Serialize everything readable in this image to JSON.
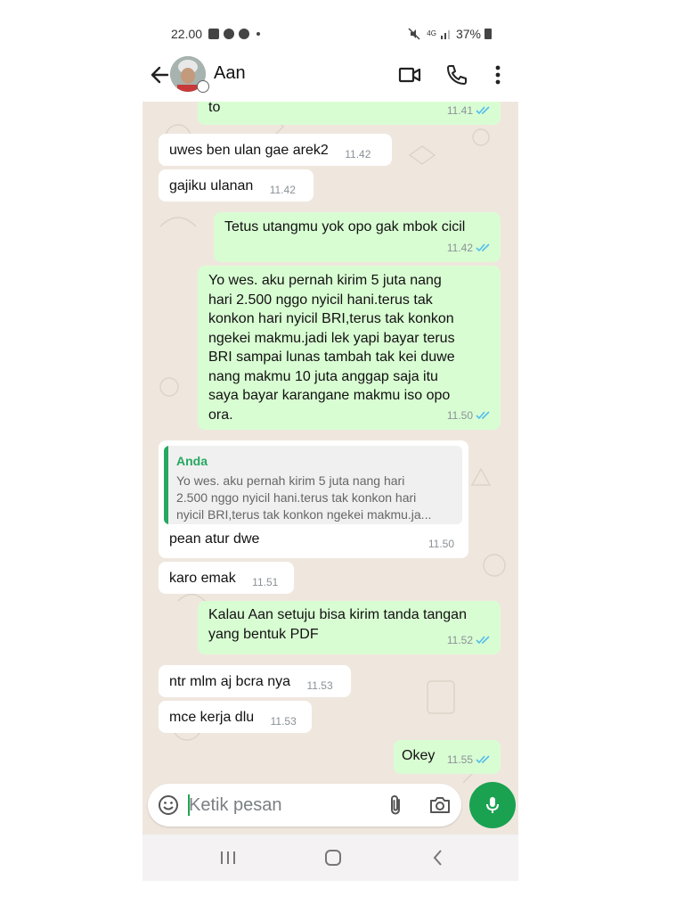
{
  "status_bar": {
    "time": "22.00",
    "network": "4G",
    "battery": "37%",
    "icons_left": [
      "gallery-icon",
      "chrome-icon",
      "chrome-icon",
      "dot"
    ],
    "icons_right": [
      "mute-icon",
      "network-icon",
      "signal-icon",
      "battery-icon"
    ]
  },
  "header": {
    "contact_name": "Aan",
    "icons": [
      "back-arrow-icon",
      "avatar",
      "video-call-icon",
      "voice-call-icon",
      "more-vert-icon"
    ]
  },
  "messages": [
    {
      "direction": "out",
      "text": "to",
      "time": "11.41",
      "read": true
    },
    {
      "direction": "in",
      "text": "uwes ben ulan gae arek2",
      "time": "11.42"
    },
    {
      "direction": "in",
      "text": "gajiku ulanan",
      "time": "11.42"
    },
    {
      "direction": "out",
      "text": "Tetus utangmu yok opo gak mbok cicil",
      "time": "11.42",
      "read": true
    },
    {
      "direction": "out",
      "text": "Yo wes. aku pernah kirim 5 juta nang\nhari 2.500 nggo nyicil hani.terus tak\nkonkon hari nyicil BRI,terus tak konkon\nngekei makmu.jadi lek yapi bayar terus\nBRI sampai lunas tambah tak kei duwe\nnang makmu 10 juta anggap saja itu\nsaya bayar karangane makmu iso opo\nora.",
      "time": "11.50",
      "read": true
    },
    {
      "direction": "in",
      "quote": {
        "author": "Anda",
        "text": "Yo wes. aku pernah kirim 5 juta nang hari\n2.500 nggo nyicil hani.terus tak konkon hari\nnyicil BRI,terus tak konkon ngekei makmu.ja..."
      },
      "text": "pean atur dwe",
      "time": "11.50"
    },
    {
      "direction": "in",
      "text": "karo emak",
      "time": "11.51"
    },
    {
      "direction": "out",
      "text": "Kalau Aan setuju bisa kirim tanda tangan\nyang bentuk PDF",
      "time": "11.52",
      "read": true
    },
    {
      "direction": "in",
      "text": "ntr mlm aj bcra nya",
      "time": "11.53"
    },
    {
      "direction": "in",
      "text": "mce kerja dlu",
      "time": "11.53"
    },
    {
      "direction": "out",
      "text": "Okey",
      "time": "11.55",
      "read": true
    }
  ],
  "composer": {
    "placeholder": "Ketik pesan",
    "value": "",
    "icons": [
      "emoji-icon",
      "attach-icon",
      "camera-icon",
      "mic-icon"
    ]
  },
  "colors": {
    "chat_bg": "#efe7de",
    "outgoing_bubble": "#d9fdd3",
    "incoming_bubble": "#ffffff",
    "accent_green": "#1aa251",
    "read_ticks": "#53bdeb",
    "quote_author": "#25a861"
  },
  "nav_bar": {
    "icons": [
      "recents-icon",
      "home-icon",
      "back-nav-icon"
    ]
  }
}
